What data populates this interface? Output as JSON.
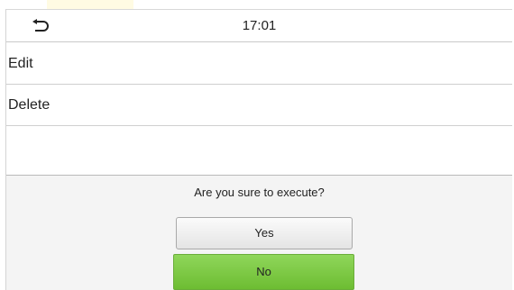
{
  "header": {
    "back_icon": "back-arrow-icon",
    "time": "17:01"
  },
  "menu": {
    "items": [
      {
        "label": "Edit"
      },
      {
        "label": "Delete"
      }
    ]
  },
  "dialog": {
    "message": "Are you sure to execute?",
    "yes_label": "Yes",
    "no_label": "No"
  },
  "colors": {
    "selected_button": "#7cc846",
    "dialog_background": "#f4f4f4"
  }
}
